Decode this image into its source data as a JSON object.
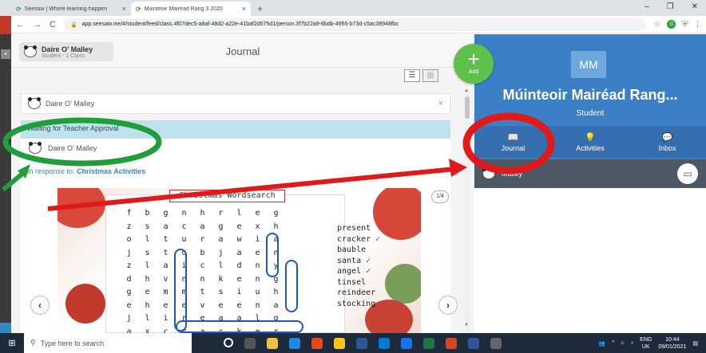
{
  "browser": {
    "tabs": [
      {
        "title": "Seesaw | Where learning happen",
        "active": false
      },
      {
        "title": "Múinteoir Mairéad Rang 3 2020",
        "active": true
      }
    ],
    "new_tab": "+",
    "url": "app.seesaw.me/#/student/feed/class.4f07dec5-a8af-48d2-a22e-41baf2d575d1/person.3f7b22a9-6bdb-4955-b73d-c5ac38948fbc"
  },
  "header": {
    "student_name": "Daire O' Malley",
    "student_sub": "Student - 1 Class",
    "title": "Journal"
  },
  "filter": {
    "name": "Daire O' Malley",
    "clear": "×"
  },
  "post": {
    "status": "Waiting for Teacher Approval",
    "author": "Daire O' Malley",
    "response_prefix": "In response to:",
    "response_title": "Christmas Activities",
    "page_indicator": "1/4"
  },
  "wordsearch": {
    "title": "Christmas Wordsearch",
    "rows": [
      [
        "f",
        "b",
        "g",
        "n",
        "h",
        "r",
        "l",
        "e",
        "g",
        "z"
      ],
      [
        "s",
        "a",
        "c",
        "a",
        "g",
        "e",
        "x",
        "h",
        "o",
        "l"
      ],
      [
        "t",
        "u",
        "r",
        "a",
        "w",
        "i",
        "a",
        "j",
        "s",
        "t"
      ],
      [
        "o",
        "b",
        "j",
        "a",
        "e",
        "n",
        "z",
        "l",
        "a",
        "i"
      ],
      [
        "c",
        "l",
        "d",
        "n",
        "y",
        "d",
        "h",
        "v",
        "n",
        "n"
      ],
      [
        "k",
        "e",
        "n",
        "g",
        "g",
        "e",
        "m",
        "m",
        "t",
        "s"
      ],
      [
        "i",
        "u",
        "h",
        "e",
        "h",
        "e",
        "e",
        "v",
        "e",
        "e"
      ],
      [
        "n",
        "a",
        "j",
        "l",
        "i",
        "r",
        "e",
        "a",
        "a",
        "l"
      ],
      [
        "g",
        "a",
        "x",
        "c",
        "r",
        "a",
        "c",
        "k",
        "e",
        "r"
      ]
    ],
    "words": [
      "present",
      "cracker",
      "bauble",
      "santa",
      "angel",
      "tinsel",
      "reindeer",
      "stocking"
    ],
    "checked": [
      "cracker",
      "santa",
      "angel"
    ]
  },
  "add_button": {
    "label": "Add"
  },
  "right_panel": {
    "initials": "MM",
    "class_name": "Múinteoir Mairéad Rang...",
    "role": "Student",
    "nav": [
      {
        "label": "Journal",
        "icon": "book-icon"
      },
      {
        "label": "Activities",
        "icon": "lightbulb-icon"
      },
      {
        "label": "Inbox",
        "icon": "chat-icon"
      }
    ],
    "student_row": "Malley"
  },
  "taskbar": {
    "search_placeholder": "Type here to search",
    "lang": "ENG",
    "region": "UK",
    "time": "10:44",
    "date": "09/01/2021"
  },
  "colors": {
    "seesaw_blue": "#3b7fc6",
    "approval_bar": "#bde3ee",
    "add_green": "#5cc24a",
    "annotation_green": "#1f9e3a",
    "annotation_red": "#e01a1a"
  }
}
